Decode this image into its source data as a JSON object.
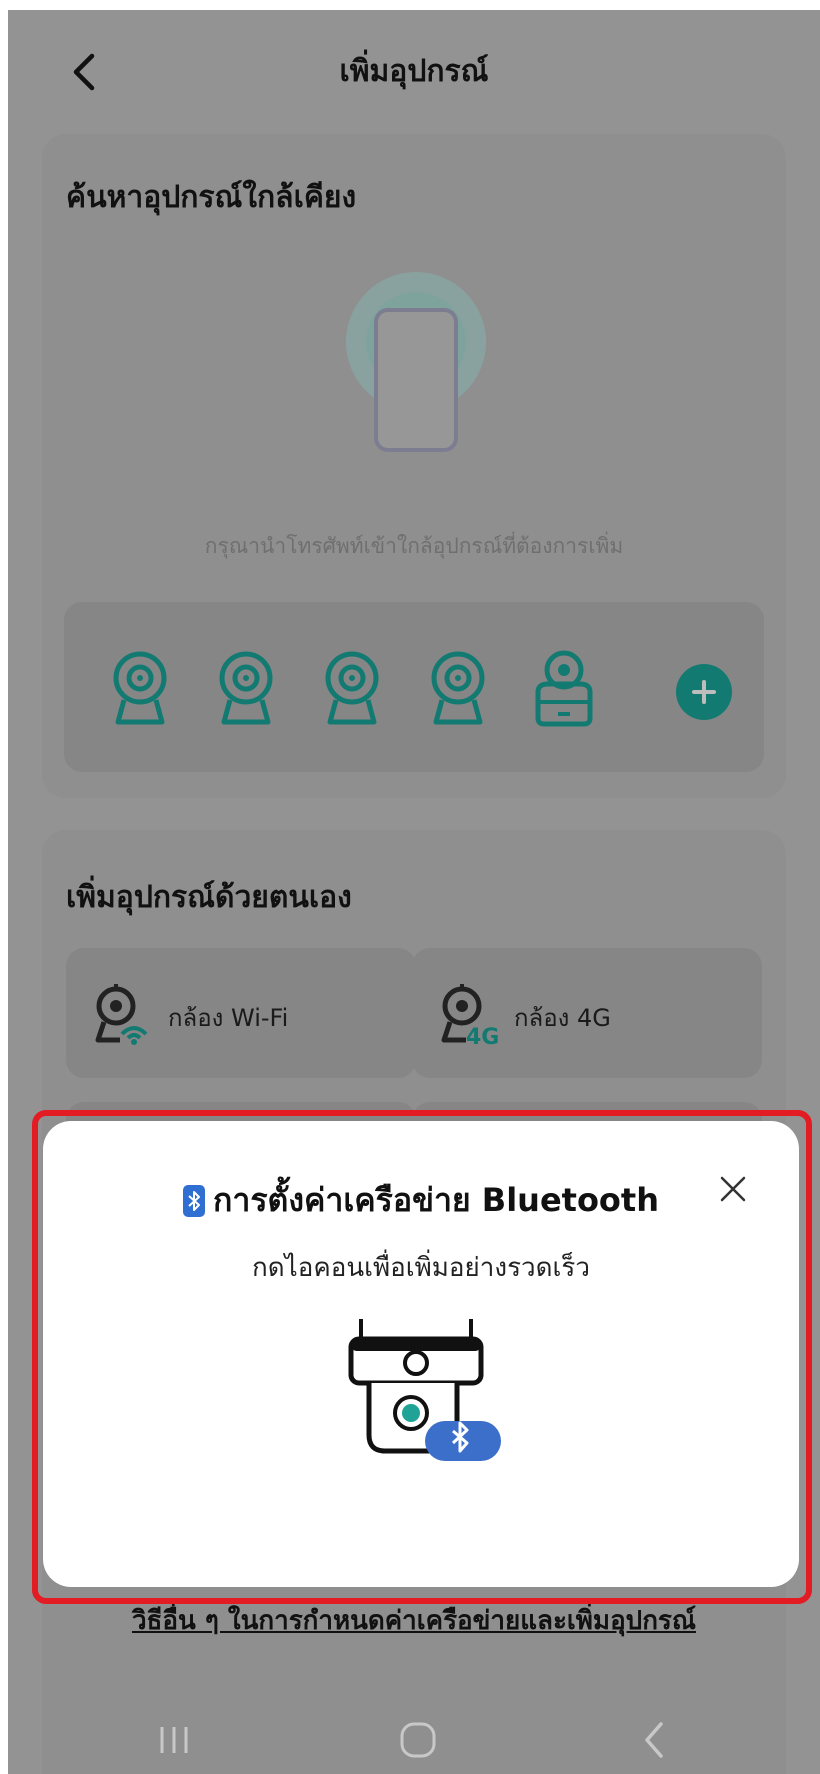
{
  "header": {
    "title": "เพิ่มอุปกรณ์"
  },
  "nearby": {
    "title": "ค้นหาอุปกรณ์ใกล้เคียง",
    "hint": "กรุณานำโทรศัพท์เข้าใกล้อุปกรณ์ที่ต้องการเพิ่ม",
    "devices": [
      "camera-icon",
      "camera-icon",
      "camera-icon",
      "camera-icon",
      "base-station-icon"
    ]
  },
  "manual": {
    "title": "เพิ่มอุปกรณ์ด้วยตนเอง",
    "options": [
      {
        "label": "กล้อง Wi-Fi",
        "icon": "wifi-camera-icon"
      },
      {
        "label": "กล้อง 4G",
        "icon": "4g-camera-icon",
        "icon_text": "4G"
      }
    ]
  },
  "bottom_link": "วิธีอื่น ๆ ในการกำหนดค่าเครือข่ายและเพิ่มอุปกรณ์",
  "popup": {
    "title": "การตั้งค่าเครือข่าย Bluetooth",
    "subtitle": "กดไอคอนเพื่อเพิ่มอย่างรวดเร็ว"
  },
  "colors": {
    "accent": "#1fa396",
    "overlay": "#939393",
    "highlight": "#e31b23",
    "bluetooth": "#2f6fd1"
  }
}
